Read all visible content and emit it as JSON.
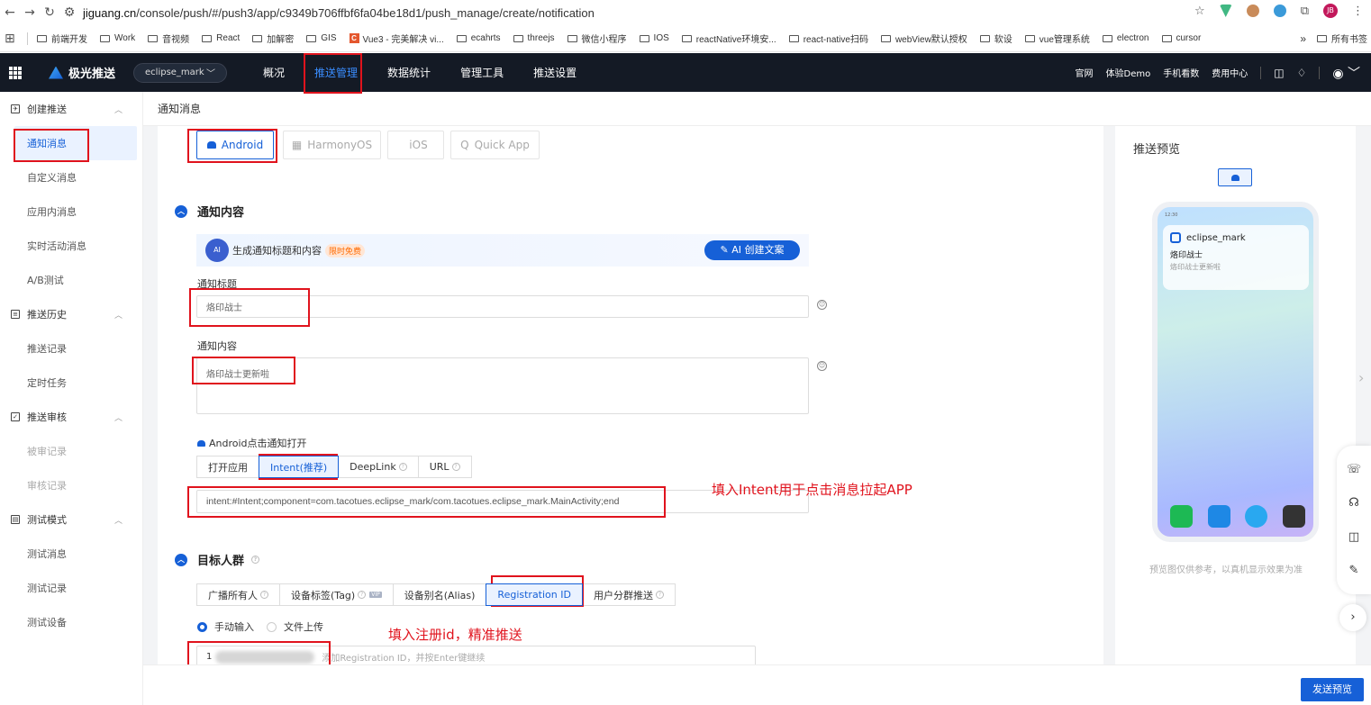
{
  "browser": {
    "url_domain": "jiguang.cn",
    "url_path": "/console/push/#/push3/app/c9349b706ffbf6fa04be18d1/push_manage/create/notification",
    "profile_initials": "JB"
  },
  "bookmarks": [
    "前端开发",
    "Work",
    "音视频",
    "React",
    "加解密",
    "GIS",
    "Vue3 - 完美解决 vi...",
    "ecahrts",
    "threejs",
    "微信小程序",
    "IOS",
    "reactNative环境安...",
    "react-native扫码",
    "webView默认授权",
    "软设",
    "vue管理系统",
    "electron",
    "cursor"
  ],
  "bookmarks_overflow": "»",
  "bookmarks_all": "所有书签",
  "topnav": {
    "brand": "极光推送",
    "app_name": "eclipse_mark",
    "menu": [
      "概况",
      "推送管理",
      "数据统计",
      "管理工具",
      "推送设置"
    ],
    "right": [
      "官网",
      "体验Demo",
      "手机看数",
      "费用中心"
    ]
  },
  "sidebar": {
    "groups": [
      {
        "label": "创建推送",
        "items": [
          "通知消息",
          "自定义消息",
          "应用内消息",
          "实时活动消息",
          "A/B测试"
        ]
      },
      {
        "label": "推送历史",
        "items": [
          "推送记录",
          "定时任务"
        ]
      },
      {
        "label": "推送审核",
        "items": [
          "被审记录",
          "审核记录"
        ]
      },
      {
        "label": "测试模式",
        "items": [
          "测试消息",
          "测试记录",
          "测试设备"
        ]
      }
    ]
  },
  "breadcrumb": "通知消息",
  "platforms": [
    "Android",
    "HarmonyOS",
    "iOS",
    "Quick App"
  ],
  "notification": {
    "section_title": "通知内容",
    "ai_text": "生成通知标题和内容",
    "ai_badge": "限时免费",
    "ai_button": "AI 创建文案",
    "title_label": "通知标题",
    "title_value": "烙印战士",
    "content_label": "通知内容",
    "content_value": "烙印战士更新啦",
    "open_label": "Android点击通知打开",
    "open_options": [
      "打开应用",
      "Intent(推荐)",
      "DeepLink",
      "URL"
    ],
    "intent_value": "intent:#Intent;component=com.tacotues.eclipse_mark/com.tacotues.eclipse_mark.MainActivity;end"
  },
  "target": {
    "section_title": "目标人群",
    "options": [
      "广播所有人",
      "设备标签(Tag)",
      "设备别名(Alias)",
      "Registration ID",
      "用户分群推送"
    ],
    "vip": "VIP",
    "input_modes": [
      "手动输入",
      "文件上传"
    ],
    "reg_prefix": "1",
    "reg_placeholder": "添加Registration ID，并按Enter键继续"
  },
  "annotations": {
    "intent_note": "填入Intent用于点击消息拉起APP",
    "regid_note": "填入注册id，精准推送"
  },
  "preview": {
    "title": "推送预览",
    "phone_time": "12:30",
    "notif_app": "eclipse_mark",
    "notif_title": "烙印战士",
    "notif_body": "烙印战士更新啦",
    "note": "预览图仅供参考，以真机显示效果为准"
  },
  "footer": {
    "send_preview": "发送预览"
  },
  "colors": {
    "accent": "#1660d7",
    "annotation": "#e0131d",
    "nav_bg": "#141a25"
  }
}
